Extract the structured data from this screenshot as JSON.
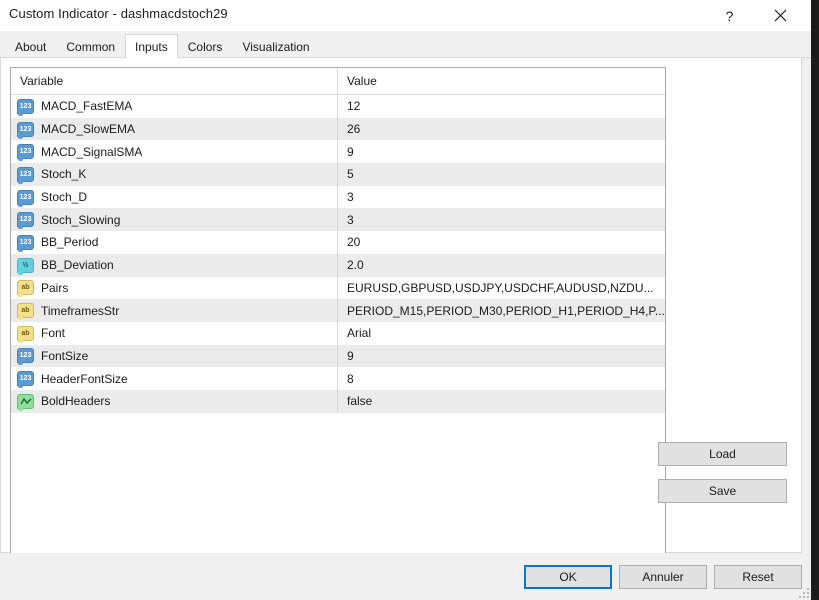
{
  "window": {
    "title": "Custom Indicator - dashmacdstoch29",
    "help_icon": "question-mark-icon",
    "close_icon": "close-icon"
  },
  "tabs": [
    {
      "label": "About",
      "active": false
    },
    {
      "label": "Common",
      "active": false
    },
    {
      "label": "Inputs",
      "active": true
    },
    {
      "label": "Colors",
      "active": false
    },
    {
      "label": "Visualization",
      "active": false
    }
  ],
  "table": {
    "columns": [
      "Variable",
      "Value"
    ],
    "rows": [
      {
        "icon": "int",
        "variable": "MACD_FastEMA",
        "value": "12"
      },
      {
        "icon": "int",
        "variable": "MACD_SlowEMA",
        "value": "26"
      },
      {
        "icon": "int",
        "variable": "MACD_SignalSMA",
        "value": "9"
      },
      {
        "icon": "int",
        "variable": "Stoch_K",
        "value": "5"
      },
      {
        "icon": "int",
        "variable": "Stoch_D",
        "value": "3"
      },
      {
        "icon": "int",
        "variable": "Stoch_Slowing",
        "value": "3"
      },
      {
        "icon": "int",
        "variable": "BB_Period",
        "value": "20"
      },
      {
        "icon": "dbl",
        "variable": "BB_Deviation",
        "value": "2.0"
      },
      {
        "icon": "str",
        "variable": "Pairs",
        "value": "EURUSD,GBPUSD,USDJPY,USDCHF,AUDUSD,NZDU..."
      },
      {
        "icon": "str",
        "variable": "TimeframesStr",
        "value": "PERIOD_M15,PERIOD_M30,PERIOD_H1,PERIOD_H4,P..."
      },
      {
        "icon": "str",
        "variable": "Font",
        "value": "Arial"
      },
      {
        "icon": "int",
        "variable": "FontSize",
        "value": "9"
      },
      {
        "icon": "int",
        "variable": "HeaderFontSize",
        "value": "8"
      },
      {
        "icon": "bool",
        "variable": "BoldHeaders",
        "value": "false"
      }
    ]
  },
  "side_buttons": [
    {
      "label": "Load"
    },
    {
      "label": "Save"
    }
  ],
  "footer_buttons": [
    {
      "label": "OK",
      "default": true
    },
    {
      "label": "Annuler",
      "default": false
    },
    {
      "label": "Reset",
      "default": false
    }
  ],
  "icon_glyphs": {
    "int": "123",
    "dbl": "½",
    "str": "ab",
    "bool": "zigzag-line-icon"
  },
  "colors": {
    "accent": "#0078d7",
    "int_icon": "#5b9bd5",
    "double_icon": "#62d0e0",
    "string_icon": "#f2e08a",
    "bool_icon": "#8fe09a",
    "row_alt": "#ebebeb",
    "dialog_bg": "#f0f0f0"
  }
}
